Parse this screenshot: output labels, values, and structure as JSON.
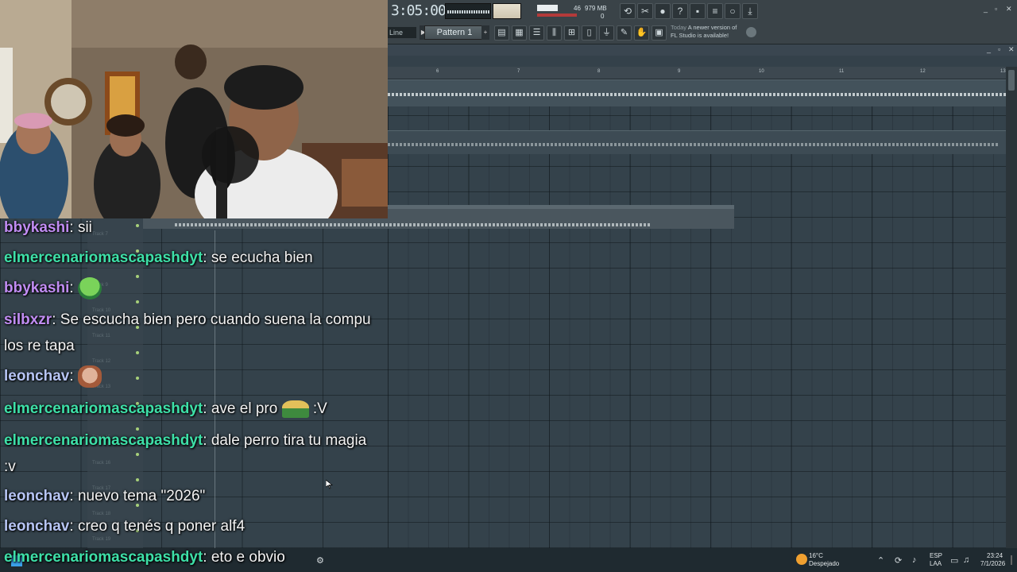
{
  "fl": {
    "time": "3:05:00",
    "cpu_value": "46",
    "memory": "979 MB",
    "polyphony": "0",
    "line_mode": "Line",
    "pattern": "Pattern 1",
    "news_day": "Today",
    "news_text1": "A newer version of",
    "news_text2": "FL Studio is available!",
    "ruler": [
      "6",
      "7",
      "8",
      "9",
      "10",
      "11",
      "12",
      "13"
    ],
    "tracks": [
      "Track 7",
      "Track 8",
      "Track 9",
      "Track 10",
      "Track 11",
      "Track 12",
      "Track 13",
      "Track 14",
      "Track 15",
      "Track 16",
      "Track 17",
      "Track 18",
      "Track 19"
    ]
  },
  "chat": [
    {
      "user": "bbykashi",
      "sep": ": ",
      "text": "sii",
      "color": "#c08cf2"
    },
    {
      "user": "elmercenariomascapashdyt",
      "sep": ": ",
      "text": "se ecucha bien",
      "color": "#3ee0a8"
    },
    {
      "user": "bbykashi",
      "sep": ": ",
      "text": "",
      "emote": "crying-emote",
      "color": "#c08cf2"
    },
    {
      "user": "silbxzr",
      "sep": ": ",
      "text": "Se escucha bien pero cuando suena la compu los re tapa",
      "color": "#c08cf2"
    },
    {
      "user": "leonchav",
      "sep": ": ",
      "text": "",
      "emote": "face-emote",
      "color": "#b6c4f4"
    },
    {
      "user": "elmercenariomascapashdyt",
      "sep": ": ",
      "text": "ave el pro",
      "after": ":V",
      "emote": "sombrero-emote",
      "color": "#3ee0a8"
    },
    {
      "user": "elmercenariomascapashdyt",
      "sep": ": ",
      "text": "dale perro tira tu magia :v",
      "color": "#3ee0a8"
    },
    {
      "user": "leonchav",
      "sep": ": ",
      "text": "nuevo tema \"2026\"",
      "color": "#b6c4f4"
    },
    {
      "user": "leonchav",
      "sep": ": ",
      "text": "creo q tenés q poner alf4",
      "color": "#b6c4f4"
    },
    {
      "user": "elmercenariomascapashdyt",
      "sep": ": ",
      "text": "eto e obvio",
      "color": "#3ee0a8"
    }
  ],
  "taskbar": {
    "temp": "16°C",
    "weather": "Despejado",
    "lang1": "ESP",
    "lang2": "LAA",
    "time": "23:24",
    "date": "7/1/2026"
  }
}
